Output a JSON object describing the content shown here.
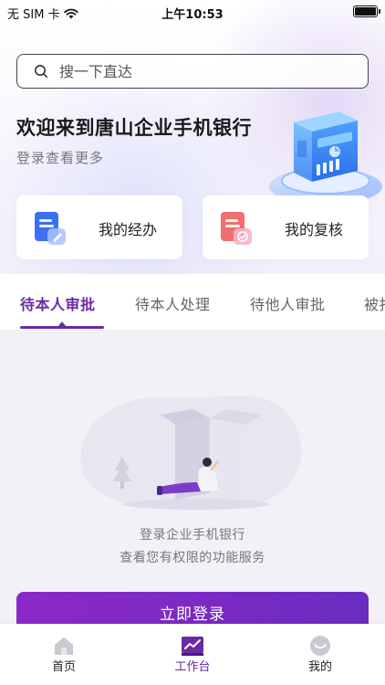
{
  "status_bar": {
    "carrier": "无 SIM 卡",
    "time": "上午10:53"
  },
  "search": {
    "placeholder": "搜一下直达"
  },
  "hero": {
    "title": "欢迎来到唐山企业手机银行",
    "subtitle": "登录查看更多"
  },
  "cards": [
    {
      "label": "我的经办",
      "icon": "document-pen-icon"
    },
    {
      "label": "我的复核",
      "icon": "document-check-icon"
    }
  ],
  "tabs": [
    {
      "label": "待本人审批",
      "active": true
    },
    {
      "label": "待本人处理",
      "active": false
    },
    {
      "label": "待他人审批",
      "active": false
    },
    {
      "label": "被打回",
      "active": false
    }
  ],
  "empty_state": {
    "line1": "登录企业手机银行",
    "line2": "查看您有权限的功能服务"
  },
  "login_button": {
    "label": "立即登录"
  },
  "tabbar": [
    {
      "label": "首页",
      "icon": "home-icon",
      "active": false
    },
    {
      "label": "工作台",
      "icon": "workbench-icon",
      "active": true
    },
    {
      "label": "我的",
      "icon": "profile-icon",
      "active": false
    }
  ],
  "colors": {
    "accent": "#6a2aa7",
    "button_gradient_start": "#8c28c8",
    "button_gradient_end": "#6a2cc0",
    "background": "#f1f1f7"
  }
}
